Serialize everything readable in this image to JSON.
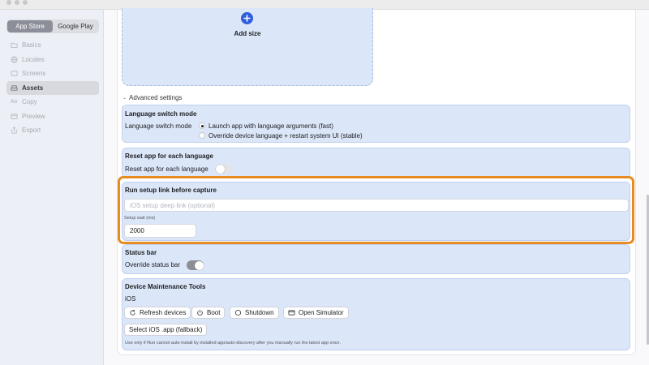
{
  "sidebar": {
    "segments": [
      {
        "label": "App Store",
        "active": true
      },
      {
        "label": "Google Play",
        "active": false
      }
    ],
    "items": [
      {
        "label": "Basics",
        "icon": "folder-icon"
      },
      {
        "label": "Locales",
        "icon": "globe-icon"
      },
      {
        "label": "Screens",
        "icon": "layers-icon"
      },
      {
        "label": "Assets",
        "icon": "stack-icon",
        "active": true
      },
      {
        "label": "Copy",
        "icon": "text-icon"
      },
      {
        "label": "Preview",
        "icon": "eye-icon"
      },
      {
        "label": "Export",
        "icon": "export-icon"
      }
    ]
  },
  "main": {
    "add_size": {
      "icon": "plus",
      "label": "Add size"
    },
    "advanced_label": "Advanced settings",
    "language_switch": {
      "title": "Language switch mode",
      "label": "Language switch mode",
      "options": [
        {
          "label": "Launch app with language arguments (fast)",
          "selected": true
        },
        {
          "label": "Override device language + restart system UI (stable)",
          "selected": false
        }
      ]
    },
    "reset_app": {
      "title": "Reset app for each language",
      "toggle_label": "Reset app for each language",
      "enabled": false
    },
    "setup_link": {
      "title": "Run setup link before capture",
      "placeholder": "iOS setup deep link (optional)",
      "wait_label": "Setup wait (ms)",
      "wait_value": "2000"
    },
    "status_bar": {
      "title": "Status bar",
      "toggle_label": "Override status bar",
      "enabled": true
    },
    "device_tools": {
      "title": "Device Maintenance Tools",
      "platform": "iOS",
      "buttons": [
        {
          "label": "Refresh devices",
          "icon": "refresh-icon"
        },
        {
          "label": "Boot",
          "icon": "power-icon"
        },
        {
          "label": "Shutdown",
          "icon": "circle-icon"
        },
        {
          "label": "Open Simulator",
          "icon": "window-icon"
        }
      ],
      "fallback_label": "Select iOS .app (fallback)",
      "note": "Use only if Run cannot auto-install by installed app/auto-discovery after you manually run the latest app once."
    }
  },
  "colors": {
    "accent": "#2f5ddd",
    "card_bg": "#dbe7f9",
    "highlight": "#e78c22"
  }
}
